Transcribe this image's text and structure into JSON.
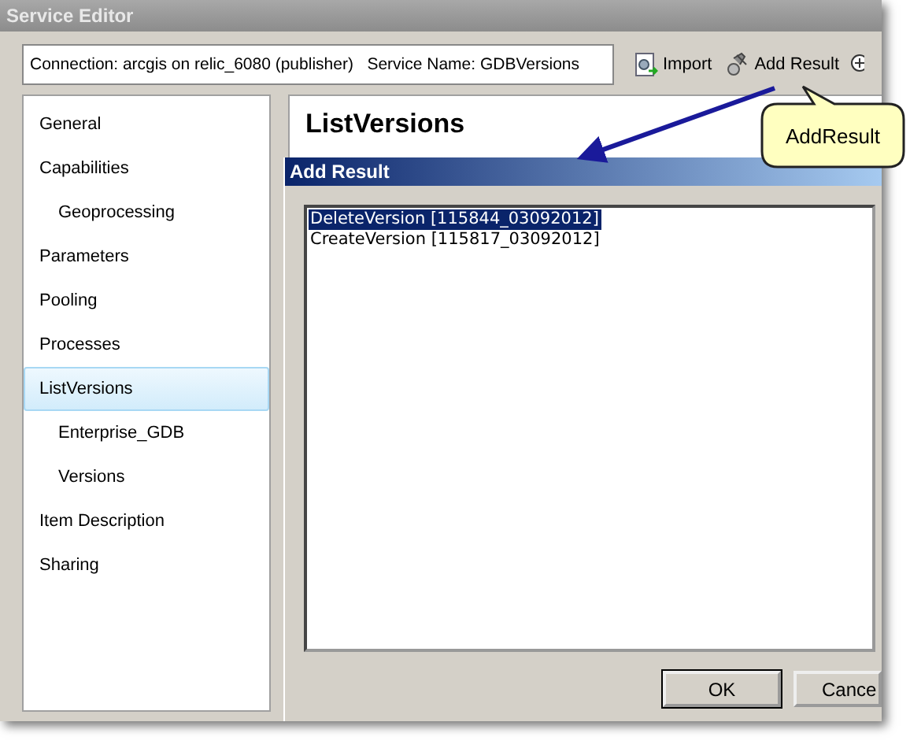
{
  "window": {
    "title": "Service Editor"
  },
  "connection": {
    "text": "Connection: arcgis on relic_6080 (publisher)   Service Name: GDBVersions"
  },
  "toolbar": [
    {
      "kind": "import",
      "label": "Import"
    },
    {
      "kind": "add-result",
      "label": "Add Result"
    },
    {
      "kind": "zoom"
    }
  ],
  "sidebar": {
    "items": [
      {
        "label": "General",
        "selected": false
      },
      {
        "label": "Capabilities",
        "selected": false,
        "children": [
          {
            "label": "Geoprocessing",
            "selected": false
          }
        ]
      },
      {
        "label": "Parameters",
        "selected": false
      },
      {
        "label": "Pooling",
        "selected": false
      },
      {
        "label": "Processes",
        "selected": false
      },
      {
        "label": "ListVersions",
        "selected": true,
        "children": [
          {
            "label": "Enterprise_GDB",
            "selected": false
          },
          {
            "label": "Versions",
            "selected": false
          }
        ]
      },
      {
        "label": "Item Description",
        "selected": false
      },
      {
        "label": "Sharing",
        "selected": false
      }
    ]
  },
  "panel": {
    "title": "ListVersions"
  },
  "dialog": {
    "title": "Add Result",
    "items": [
      {
        "label": "DeleteVersion [115844_03092012]",
        "selected": true
      },
      {
        "label": "CreateVersion [115817_03092012]",
        "selected": false
      }
    ],
    "buttons": [
      "OK",
      "Cance"
    ]
  },
  "callout": {
    "text": "AddResult"
  }
}
